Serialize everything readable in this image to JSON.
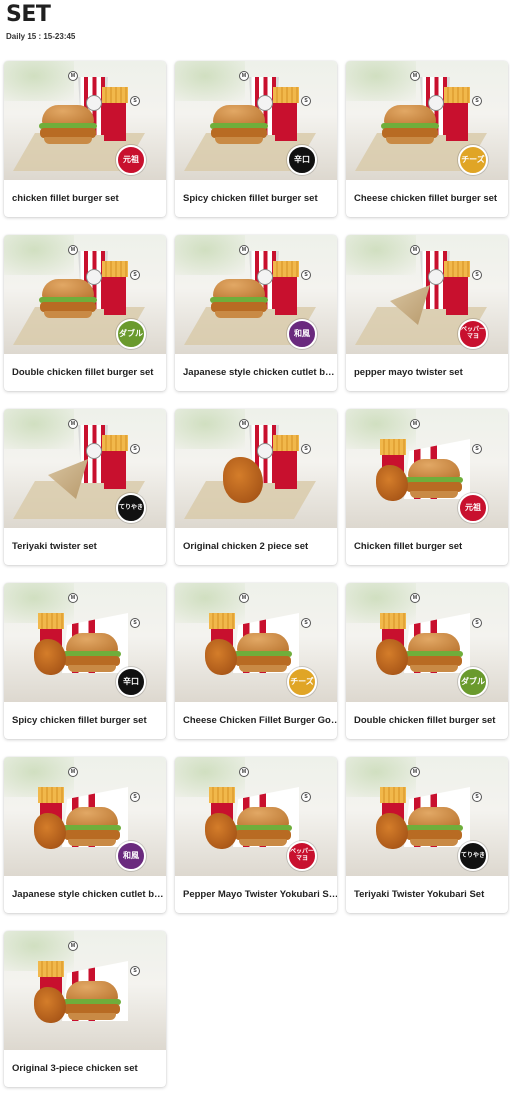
{
  "header": {
    "title": "SET",
    "hours": "Daily 15 : 15-23:45"
  },
  "icons": {
    "medium": "M",
    "small": "S"
  },
  "items": [
    {
      "name": "chicken fillet burger set",
      "food": "burger",
      "tag": "元祖",
      "tag_color": "#c8102e"
    },
    {
      "name": "Spicy chicken fillet burger set",
      "food": "burger",
      "tag": "辛口",
      "tag_color": "#111111"
    },
    {
      "name": "Cheese chicken fillet burger set",
      "food": "burger",
      "tag": "チーズ",
      "tag_color": "#e0a526"
    },
    {
      "name": "Double chicken fillet burger set",
      "food": "burger",
      "tag": "ダブル",
      "tag_color": "#6a9a2d"
    },
    {
      "name": "Japanese style chicken cutlet b…",
      "food": "burger",
      "tag": "和風",
      "tag_color": "#6a2a7e"
    },
    {
      "name": "pepper mayo twister set",
      "food": "twister",
      "tag": "ペッパー\nマヨ",
      "tag_color": "#c8102e"
    },
    {
      "name": "Teriyaki twister set",
      "food": "twister",
      "tag": "てりやき",
      "tag_color": "#111111"
    },
    {
      "name": "Original chicken 2 piece set",
      "food": "chicken",
      "tag": "",
      "tag_color": ""
    },
    {
      "name": "Chicken fillet burger set",
      "food": "box",
      "tag": "元祖",
      "tag_color": "#c8102e"
    },
    {
      "name": "Spicy chicken fillet burger set",
      "food": "box",
      "tag": "辛口",
      "tag_color": "#111111"
    },
    {
      "name": "Cheese Chicken Fillet Burger Go…",
      "food": "box",
      "tag": "チーズ",
      "tag_color": "#e0a526"
    },
    {
      "name": "Double chicken fillet burger set",
      "food": "box",
      "tag": "ダブル",
      "tag_color": "#6a9a2d"
    },
    {
      "name": "Japanese style chicken cutlet b…",
      "food": "box",
      "tag": "和風",
      "tag_color": "#6a2a7e"
    },
    {
      "name": "Pepper Mayo Twister Yokubari S…",
      "food": "box",
      "tag": "ペッパー\nマヨ",
      "tag_color": "#c8102e"
    },
    {
      "name": "Teriyaki Twister Yokubari Set",
      "food": "box",
      "tag": "てりやき",
      "tag_color": "#111111"
    },
    {
      "name": "Original 3-piece chicken set",
      "food": "box",
      "tag": "",
      "tag_color": ""
    }
  ]
}
